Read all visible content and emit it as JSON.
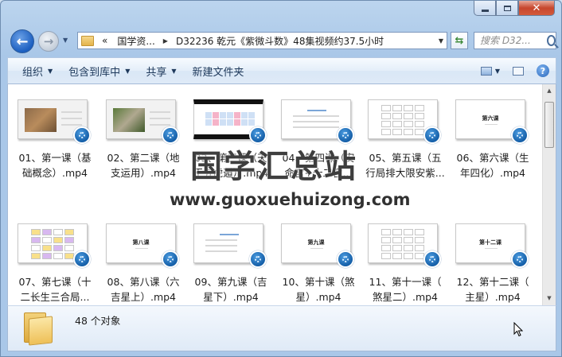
{
  "window": {
    "caption_buttons": [
      "minimize",
      "maximize",
      "close"
    ]
  },
  "nav": {
    "address_segments": [
      "«",
      "国学资...",
      "D32236 乾元《紫微斗数》48集视频约37.5小时"
    ],
    "search_placeholder": "搜索 D32..."
  },
  "toolbar": {
    "items": [
      {
        "label": "组织",
        "dropdown": true
      },
      {
        "label": "包含到库中",
        "dropdown": true
      },
      {
        "label": "共享",
        "dropdown": true
      },
      {
        "label": "新建文件夹",
        "dropdown": false
      }
    ]
  },
  "files": [
    {
      "line1": "01、第一课（基",
      "line2": "础概念）.mp4",
      "thumb": "slide-photo"
    },
    {
      "line1": "02、第二课（地",
      "line2": "支运用）.mp4",
      "thumb": "slide-green"
    },
    {
      "line1": "03、第三课（天",
      "line2": "干五虎遁）.mp4",
      "thumb": "slide-table"
    },
    {
      "line1": "04、第四课（安",
      "line2": "命宫+十二宫...",
      "thumb": "slide-text"
    },
    {
      "line1": "05、第五课（五",
      "line2": "行局排大限安紫...",
      "thumb": "slide-chart"
    },
    {
      "line1": "06、第六课（生",
      "line2": "年四化）.mp4",
      "thumb": "slide-title",
      "thumb_text": "第六课"
    },
    {
      "line1": "07、第七课（十",
      "line2": "二长生三合局...",
      "thumb": "slide-table2"
    },
    {
      "line1": "08、第八课（六",
      "line2": "吉星上）.mp4",
      "thumb": "slide-title",
      "thumb_text": "第八课"
    },
    {
      "line1": "09、第九课（吉",
      "line2": "星下）.mp4",
      "thumb": "slide-list"
    },
    {
      "line1": "10、第十课（煞",
      "line2": "星）.mp4",
      "thumb": "slide-title",
      "thumb_text": "第九课"
    },
    {
      "line1": "11、第十一课（",
      "line2": "煞星二）.mp4",
      "thumb": "slide-table3"
    },
    {
      "line1": "12、第十二课（",
      "line2": "主星）.mp4",
      "thumb": "slide-title",
      "thumb_text": "第十二课"
    }
  ],
  "watermark": {
    "cn": "国学汇总站",
    "en": "www.guoxuehuizong.com"
  },
  "details": {
    "count_text": "48 个对象"
  },
  "colors": {
    "accent": "#1c5fc0",
    "badge": "#155fa8",
    "close": "#c7462d"
  }
}
